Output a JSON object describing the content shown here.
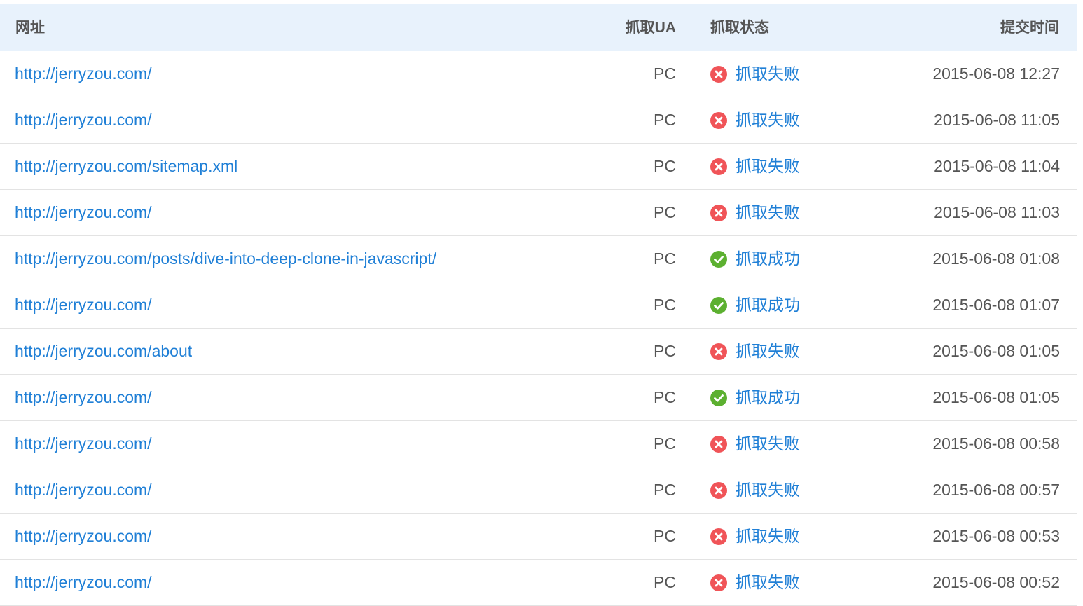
{
  "colors": {
    "header_bg": "#e8f2fc",
    "link": "#1f7fd6",
    "fail": "#f05458",
    "success": "#5cb030",
    "text": "#555555"
  },
  "table": {
    "columns": {
      "url": "网址",
      "ua": "抓取UA",
      "status": "抓取状态",
      "time": "提交时间"
    },
    "rows": [
      {
        "url": "http://jerryzou.com/",
        "ua": "PC",
        "status": "抓取失败",
        "status_icon": "fail-icon",
        "time": "2015-06-08 12:27"
      },
      {
        "url": "http://jerryzou.com/",
        "ua": "PC",
        "status": "抓取失败",
        "status_icon": "fail-icon",
        "time": "2015-06-08 11:05"
      },
      {
        "url": "http://jerryzou.com/sitemap.xml",
        "ua": "PC",
        "status": "抓取失败",
        "status_icon": "fail-icon",
        "time": "2015-06-08 11:04"
      },
      {
        "url": "http://jerryzou.com/",
        "ua": "PC",
        "status": "抓取失败",
        "status_icon": "fail-icon",
        "time": "2015-06-08 11:03"
      },
      {
        "url": "http://jerryzou.com/posts/dive-into-deep-clone-in-javascript/",
        "ua": "PC",
        "status": "抓取成功",
        "status_icon": "success-icon",
        "time": "2015-06-08 01:08"
      },
      {
        "url": "http://jerryzou.com/",
        "ua": "PC",
        "status": "抓取成功",
        "status_icon": "success-icon",
        "time": "2015-06-08 01:07"
      },
      {
        "url": "http://jerryzou.com/about",
        "ua": "PC",
        "status": "抓取失败",
        "status_icon": "fail-icon",
        "time": "2015-06-08 01:05"
      },
      {
        "url": "http://jerryzou.com/",
        "ua": "PC",
        "status": "抓取成功",
        "status_icon": "success-icon",
        "time": "2015-06-08 01:05"
      },
      {
        "url": "http://jerryzou.com/",
        "ua": "PC",
        "status": "抓取失败",
        "status_icon": "fail-icon",
        "time": "2015-06-08 00:58"
      },
      {
        "url": "http://jerryzou.com/",
        "ua": "PC",
        "status": "抓取失败",
        "status_icon": "fail-icon",
        "time": "2015-06-08 00:57"
      },
      {
        "url": "http://jerryzou.com/",
        "ua": "PC",
        "status": "抓取失败",
        "status_icon": "fail-icon",
        "time": "2015-06-08 00:53"
      },
      {
        "url": "http://jerryzou.com/",
        "ua": "PC",
        "status": "抓取失败",
        "status_icon": "fail-icon",
        "time": "2015-06-08 00:52"
      }
    ]
  }
}
